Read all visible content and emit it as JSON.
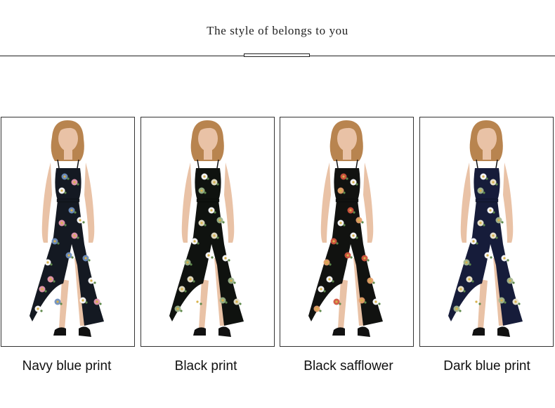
{
  "header": {
    "title": "The style of belongs to you"
  },
  "products": [
    {
      "label": "Navy blue print",
      "dress_color": "#141922",
      "flower_colors": [
        "#6f8fbf",
        "#e79ab0",
        "#ffffff"
      ]
    },
    {
      "label": "Black print",
      "dress_color": "#0f120f",
      "flower_colors": [
        "#ffffff",
        "#e8e2c8",
        "#9cb48a"
      ]
    },
    {
      "label": "Black safflower",
      "dress_color": "#111210",
      "flower_colors": [
        "#d2553f",
        "#ffffff",
        "#e6a06a"
      ]
    },
    {
      "label": "Dark blue print",
      "dress_color": "#161c3a",
      "flower_colors": [
        "#ffffff",
        "#f0ead2",
        "#a5b88f"
      ]
    }
  ]
}
